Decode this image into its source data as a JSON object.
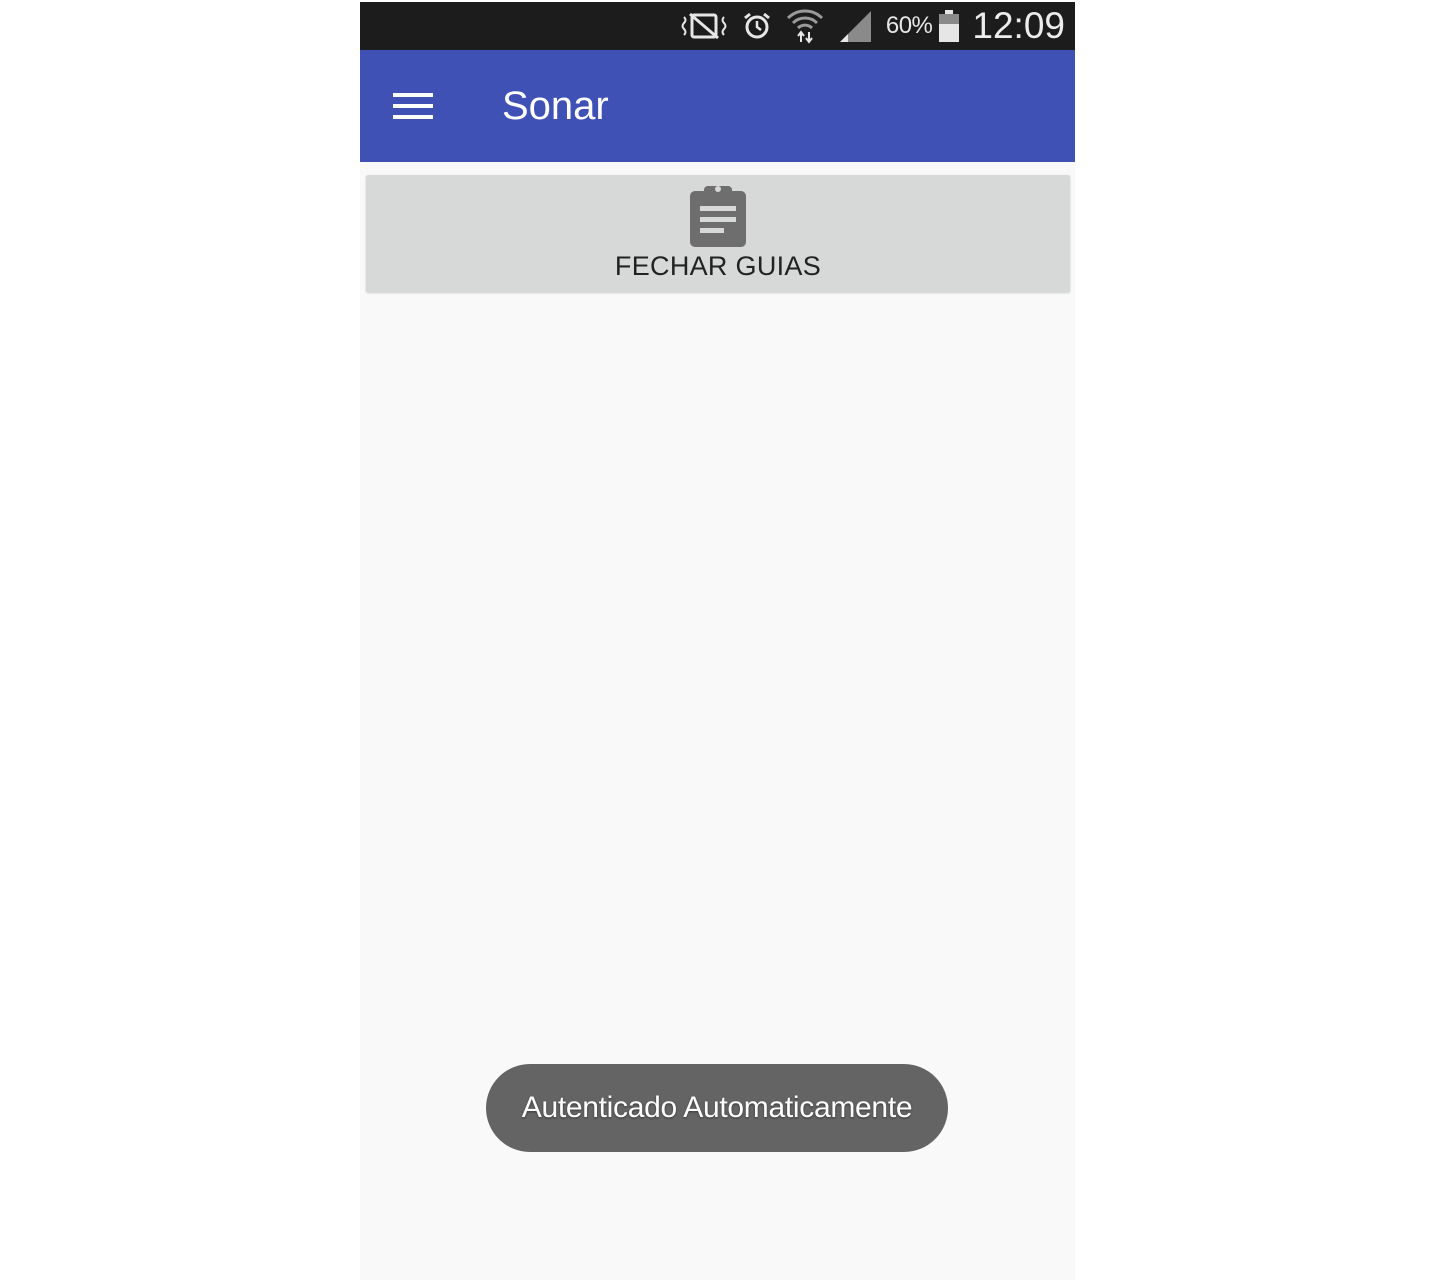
{
  "status_bar": {
    "battery_percent": "60%",
    "time": "12:09",
    "icons": [
      "vibrate-mute-icon",
      "alarm-icon",
      "wifi-icon",
      "signal-icon",
      "battery-icon"
    ]
  },
  "app_bar": {
    "title": "Sonar",
    "menu_icon": "hamburger-menu-icon",
    "color": "#3f51b5"
  },
  "main": {
    "action_card": {
      "label": "FECHAR GUIAS",
      "icon": "clipboard-icon"
    }
  },
  "toast": {
    "message": "Autenticado Automaticamente"
  }
}
